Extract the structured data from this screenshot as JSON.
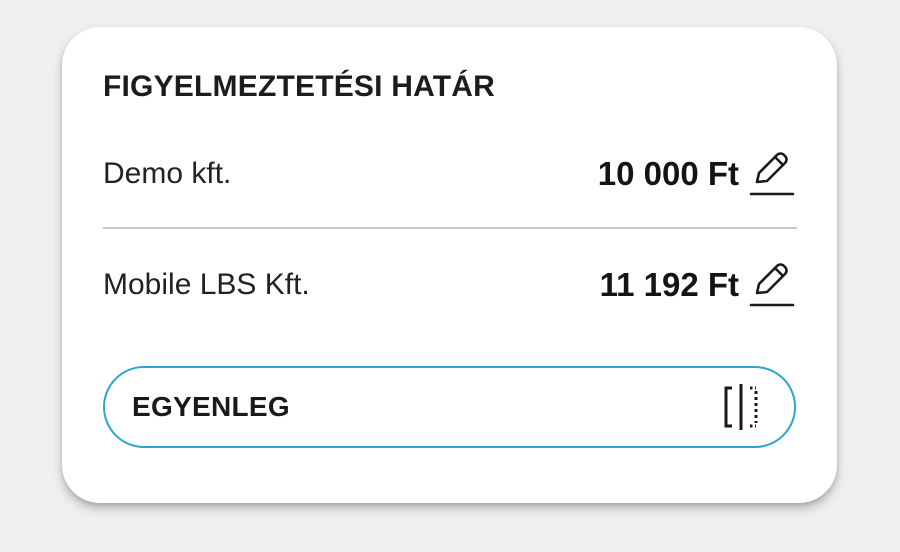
{
  "card": {
    "title": "FIGYELMEZTETÉSI HATÁR",
    "rows": [
      {
        "label": "Demo kft.",
        "value": "10 000 Ft",
        "icon": "edit-pencil-icon"
      },
      {
        "label": "Mobile LBS Kft.",
        "value": "11 192 Ft",
        "icon": "edit-pencil-icon"
      }
    ],
    "balance_button": {
      "label": "EGYENLEG",
      "icon": "split-view-icon"
    }
  },
  "colors": {
    "background": "#efefef",
    "card": "#ffffff",
    "accent_border": "#2aa6cf",
    "divider": "#c8c8c8",
    "text": "#1c1c1c"
  }
}
